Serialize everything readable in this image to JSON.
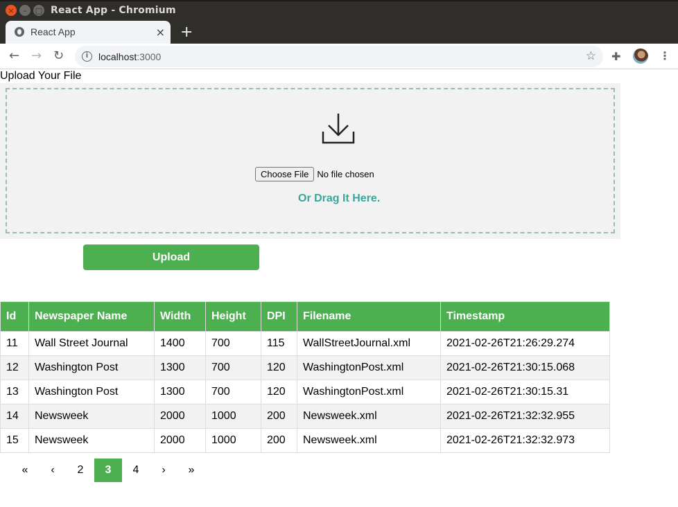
{
  "window": {
    "title": "React App - Chromium",
    "controls": {
      "close": "×",
      "minimize": "–",
      "maximize": "□"
    }
  },
  "tab": {
    "label": "React App",
    "close": "×",
    "new_tab": "+"
  },
  "toolbar": {
    "back": "←",
    "forward": "→",
    "reload": "↻",
    "url_host": "localhost",
    "url_port": ":3000",
    "info": "i",
    "star": "☆",
    "extensions": "✚",
    "menu": "⋮"
  },
  "upload": {
    "heading": "Upload Your File",
    "choose_label": "Choose File",
    "no_file": "No file chosen",
    "drag_text": "Or Drag It Here.",
    "button_label": "Upload"
  },
  "table": {
    "headers": [
      "Id",
      "Newspaper Name",
      "Width",
      "Height",
      "DPI",
      "Filename",
      "Timestamp"
    ],
    "rows": [
      [
        "11",
        "Wall Street Journal",
        "1400",
        "700",
        "115",
        "WallStreetJournal.xml",
        "2021-02-26T21:26:29.274"
      ],
      [
        "12",
        "Washington Post",
        "1300",
        "700",
        "120",
        "WashingtonPost.xml",
        "2021-02-26T21:30:15.068"
      ],
      [
        "13",
        "Washington Post",
        "1300",
        "700",
        "120",
        "WashingtonPost.xml",
        "2021-02-26T21:30:15.31"
      ],
      [
        "14",
        "Newsweek",
        "2000",
        "1000",
        "200",
        "Newsweek.xml",
        "2021-02-26T21:32:32.955"
      ],
      [
        "15",
        "Newsweek",
        "2000",
        "1000",
        "200",
        "Newsweek.xml",
        "2021-02-26T21:32:32.973"
      ]
    ]
  },
  "pagination": {
    "first": "«",
    "prev": "‹",
    "pages": [
      "2",
      "3",
      "4"
    ],
    "active": "3",
    "next": "›",
    "last": "»"
  },
  "colors": {
    "accent": "#4caf50",
    "drag_text": "#3ba59b",
    "row_alt": "#f2f2f2"
  }
}
